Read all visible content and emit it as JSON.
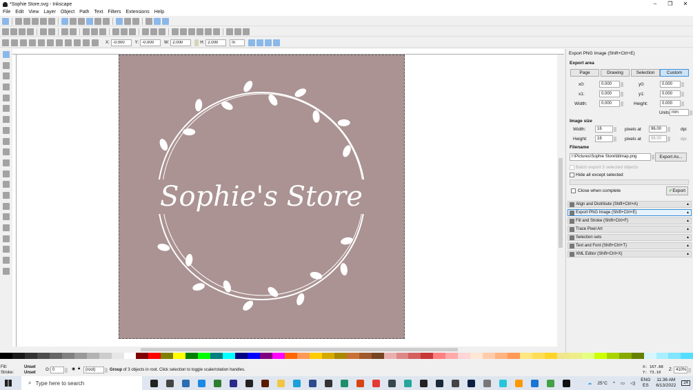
{
  "window": {
    "title": "*Sophie Store.svg - Inkscape",
    "minimize": "–",
    "maximize": "❐",
    "close": "✕"
  },
  "menu": [
    "File",
    "Edit",
    "View",
    "Layer",
    "Object",
    "Path",
    "Text",
    "Filters",
    "Extensions",
    "Help"
  ],
  "toolbar_snap": [
    "snap-toggle",
    "snap-bbox",
    "snap-bbox-edge",
    "snap-bbox-corner",
    "snap-bbox-midpoint",
    "snap-bbox-center",
    "snap-nodes",
    "snap-path",
    "snap-path-intersection",
    "snap-cusp",
    "snap-smooth",
    "snap-line-midpoint",
    "snap-object-midpoint",
    "snap-rotation-center",
    "snap-text-baseline",
    "snap-page-border",
    "snap-grid",
    "snap-guide"
  ],
  "toolbar_commands": [
    "new",
    "open",
    "save",
    "print",
    "import",
    "export",
    "undo",
    "redo",
    "duplicate",
    "cut",
    "paste",
    "zoom-selection",
    "zoom-drawing",
    "zoom-page",
    "clone",
    "group",
    "ungroup",
    "node-editor",
    "transform",
    "fill-stroke",
    "text-font",
    "layers",
    "xml-editor",
    "align",
    "preferences",
    "document-properties"
  ],
  "toolbar_select": {
    "x_label": "X:",
    "x": "-0.000",
    "y_label": "Y:",
    "y": "-0.000",
    "w_label": "W:",
    "w": "2.000",
    "h_label": "H:",
    "h": "2.000",
    "units": "in"
  },
  "tools": [
    "selector",
    "node",
    "tweak",
    "zoom",
    "measure",
    "rectangle",
    "3d-box",
    "ellipse",
    "star",
    "spiral",
    "pencil",
    "pen",
    "calligraphy",
    "text",
    "spray",
    "eraser",
    "bucket",
    "gradient",
    "mesh",
    "dropper",
    "connector"
  ],
  "canvas": {
    "page_color": "#ab9393",
    "logo_text": "Sophie's Store"
  },
  "export_panel": {
    "title": "Export PNG Image (Shift+Ctrl+E)",
    "export_area": "Export area",
    "area_buttons": [
      "Page",
      "Drawing",
      "Selection",
      "Custom"
    ],
    "x0_label": "x0:",
    "x0": "0.000",
    "y0_label": "y0:",
    "y0": "0.000",
    "x1_label": "x1:",
    "x1": "0.000",
    "y1_label": "y1:",
    "y1": "0.000",
    "width_label": "Width:",
    "width": "0.000",
    "height_label": "Height:",
    "height": "0.000",
    "units_label": "Units:",
    "units": "mm",
    "image_size": "Image size",
    "img_width_label": "Width:",
    "img_width": "16",
    "img_height_label": "Height:",
    "img_height": "16",
    "pixels_at": "pixels at",
    "dpi_value": "96.00",
    "dpi": "dpi",
    "filename_label": "Filename",
    "filename": "I:\\Pictures\\Sophie Store\\bitmap.png",
    "export_as": "Export As...",
    "batch": "Batch export 3 selected objects",
    "hide_all": "Hide all except selected",
    "close_when": "Close when complete",
    "export": "Export"
  },
  "docks": [
    "Align and Distribute (Shift+Ctrl+A)",
    "Export PNG Image (Shift+Ctrl+E)",
    "Fill and Stroke (Shift+Ctrl+F)",
    "Trace Pixel Art",
    "Selection sets",
    "Text and Font (Shift+Ctrl+T)",
    "XML Editor (Shift+Ctrl+X)"
  ],
  "status": {
    "fill_label": "Fill:",
    "fill": "Unset",
    "stroke_label": "Stroke:",
    "stroke": "Unset",
    "opacity_label": "O:",
    "opacity": "0",
    "layer": "(root)",
    "message_bold": "Group",
    "message": " of 3 objects in root. Click selection to toggle scale/rotation handles.",
    "x_label": "X:",
    "x": "167.88",
    "y_label": "Y:",
    "y": "73.10",
    "zoom_label": "Z:",
    "zoom": "410%"
  },
  "palette": [
    "#000000",
    "#1a1a1a",
    "#333333",
    "#4d4d4d",
    "#666666",
    "#808080",
    "#999999",
    "#b3b3b3",
    "#cccccc",
    "#e6e6e6",
    "#ffffff",
    "#800000",
    "#ff0000",
    "#808000",
    "#ffff00",
    "#008000",
    "#00ff00",
    "#008080",
    "#00ffff",
    "#000080",
    "#0000ff",
    "#800080",
    "#ff00ff",
    "#ff6600",
    "#ff9955",
    "#ffcc00",
    "#d4aa00",
    "#aa8800",
    "#c87137",
    "#a05a2c",
    "#784421",
    "#e9afaf",
    "#de8787",
    "#d35f5f",
    "#c83737",
    "#ff8080",
    "#ffaaaa",
    "#ffd5d5",
    "#ffe6d5",
    "#ffccaa",
    "#ffb380",
    "#ff9955",
    "#ffe680",
    "#ffdd55",
    "#ffd42a",
    "#f0e68c",
    "#eeee88",
    "#e5ff80",
    "#ccff00",
    "#aad400",
    "#88aa00",
    "#668000",
    "#d5f6ff",
    "#aaeeff",
    "#80e5ff",
    "#55ddff"
  ],
  "taskbar": {
    "search": "Type here to search",
    "weather": "25°C",
    "lang1": "ENG",
    "lang2": "ES",
    "time": "11:36 AM",
    "date": "6/13/2022",
    "notifications": "24",
    "apps": [
      {
        "name": "cortana",
        "color": "#222"
      },
      {
        "name": "task-view",
        "color": "#444"
      },
      {
        "name": "store",
        "color": "#2b6cb0"
      },
      {
        "name": "mail",
        "color": "#1e88e5"
      },
      {
        "name": "game-app",
        "color": "#2e7d32"
      },
      {
        "name": "audition",
        "color": "#2a2a8a"
      },
      {
        "name": "unreal",
        "color": "#222"
      },
      {
        "name": "illustrator",
        "color": "#5a1a00"
      },
      {
        "name": "file-explorer",
        "color": "#f4c542"
      },
      {
        "name": "edge",
        "color": "#1a9fd9"
      },
      {
        "name": "app-blue",
        "color": "#2c4b8c"
      },
      {
        "name": "app-dark",
        "color": "#333"
      },
      {
        "name": "app-green",
        "color": "#1e8f6a"
      },
      {
        "name": "app-red",
        "color": "#d84315"
      },
      {
        "name": "chrome",
        "color": "#e53935"
      },
      {
        "name": "app-globe",
        "color": "#37474f"
      },
      {
        "name": "app-teal",
        "color": "#26a69a"
      },
      {
        "name": "inkscape",
        "color": "#222"
      },
      {
        "name": "steam",
        "color": "#1b2838"
      },
      {
        "name": "app-mono",
        "color": "#444"
      },
      {
        "name": "photoshop",
        "color": "#0a1f44"
      },
      {
        "name": "app-gray",
        "color": "#777"
      },
      {
        "name": "app-cyan",
        "color": "#26c6da"
      },
      {
        "name": "app-orange",
        "color": "#ff9800"
      },
      {
        "name": "app-chart",
        "color": "#1976d2"
      },
      {
        "name": "app-lime",
        "color": "#43a047"
      },
      {
        "name": "inkscape-active",
        "color": "#111"
      }
    ]
  }
}
